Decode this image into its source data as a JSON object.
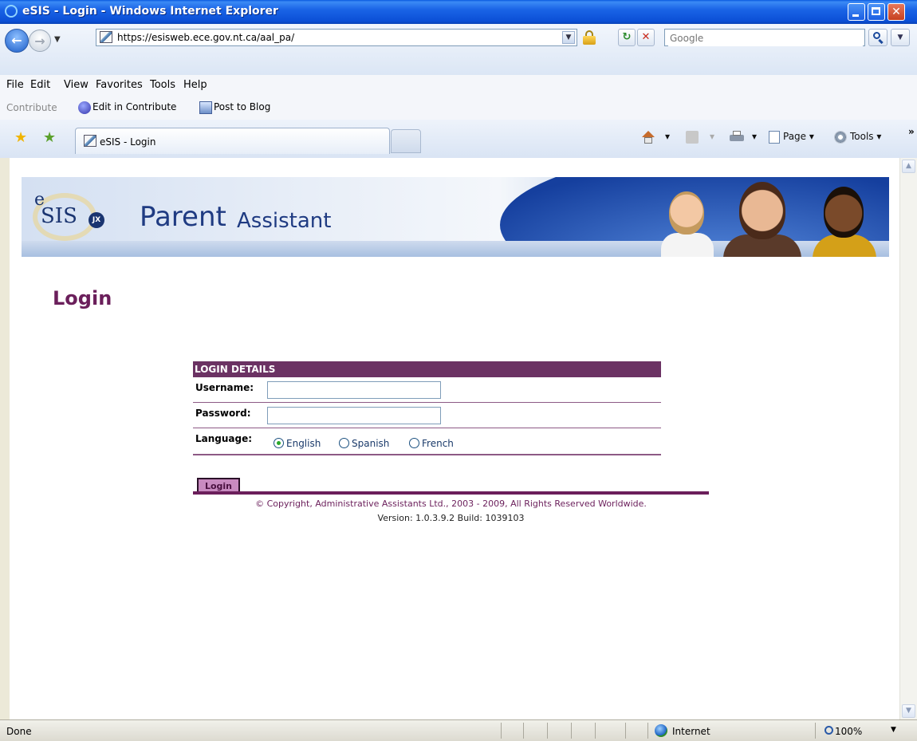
{
  "window": {
    "title": "eSIS - Login - Windows Internet Explorer"
  },
  "address_bar": {
    "url": "https://esisweb.ece.gov.nt.ca/aal_pa/",
    "search_placeholder": "Google"
  },
  "menu": {
    "items": [
      "File",
      "Edit",
      "View",
      "Favorites",
      "Tools",
      "Help"
    ]
  },
  "contribute_bar": {
    "label": "Contribute",
    "edit": "Edit in Contribute",
    "post": "Post to Blog"
  },
  "tabs": [
    {
      "label": "eSIS - Login"
    }
  ],
  "command_bar": {
    "page": "Page",
    "tools": "Tools"
  },
  "banner": {
    "logo_e": "e",
    "logo_text": "SIS",
    "logo_badge": "JX",
    "app_name_main": "Parent",
    "app_name_sub": "Assistant"
  },
  "page": {
    "title": "Login"
  },
  "login_form": {
    "header": "LOGIN DETAILS",
    "username_label": "Username:",
    "username_value": "",
    "password_label": "Password:",
    "password_value": "",
    "language_label": "Language:",
    "languages": [
      "English",
      "Spanish",
      "French"
    ],
    "selected_language": "English",
    "submit_label": "Login"
  },
  "footer": {
    "copyright": "© Copyright, Administrative Assistants Ltd., 2003 - 2009, All Rights Reserved Worldwide.",
    "version": "Version: 1.0.3.9.2 Build: 1039103"
  },
  "status_bar": {
    "status": "Done",
    "zone": "Internet",
    "zoom": "100%"
  },
  "colors": {
    "accent": "#6b1f5b",
    "header_bg": "#6b3263",
    "button_bg": "#c88ac0",
    "brand_blue": "#1f3b82"
  }
}
